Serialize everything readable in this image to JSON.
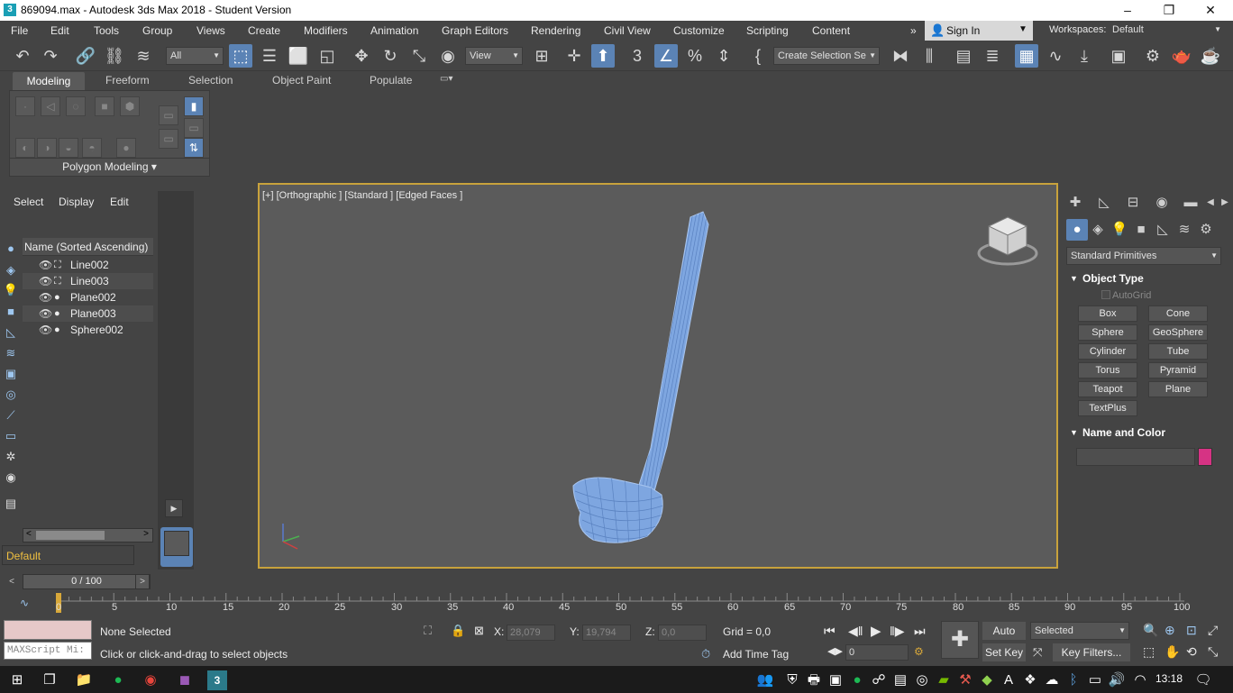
{
  "window": {
    "title": "869094.max - Autodesk 3ds Max 2018 - Student Version",
    "app_icon": "3",
    "min": "–",
    "restore": "❐",
    "close": "✕"
  },
  "menu": {
    "items": [
      "File",
      "Edit",
      "Tools",
      "Group",
      "Views",
      "Create",
      "Modifiers",
      "Animation",
      "Graph Editors",
      "Rendering",
      "Civil View",
      "Customize",
      "Scripting",
      "Content"
    ],
    "more": "»",
    "sign_in": "Sign In",
    "workspaces_label": "Workspaces:",
    "workspace_value": "Default"
  },
  "toolbar": {
    "filter_value": "All",
    "refcoord_value": "View",
    "selection_set_placeholder": "Create Selection Se"
  },
  "ribbon": {
    "tabs": [
      "Modeling",
      "Freeform",
      "Selection",
      "Object Paint",
      "Populate"
    ],
    "panel_label": "Polygon Modeling ▾"
  },
  "scene_explorer": {
    "tabs": [
      "Select",
      "Display",
      "Edit"
    ],
    "header": "Name (Sorted Ascending)",
    "rows": [
      {
        "name": "Line002",
        "type": "shape"
      },
      {
        "name": "Line003",
        "type": "shape"
      },
      {
        "name": "Plane002",
        "type": "geometry"
      },
      {
        "name": "Plane003",
        "type": "geometry"
      },
      {
        "name": "Sphere002",
        "type": "geometry"
      }
    ],
    "layer": "Default"
  },
  "viewport": {
    "label": "[+] [Orthographic ] [Standard ] [Edged Faces ]",
    "object_color": "#7ea6e0",
    "border_color": "#c8a23c"
  },
  "command_panel": {
    "category": "Standard Primitives",
    "object_type_title": "Object Type",
    "autogrid": "AutoGrid",
    "primitives": [
      "Box",
      "Cone",
      "Sphere",
      "GeoSphere",
      "Cylinder",
      "Tube",
      "Torus",
      "Pyramid",
      "Teapot",
      "Plane",
      "TextPlus"
    ],
    "name_color_title": "Name and Color",
    "object_color_swatch": "#d63384"
  },
  "timeline": {
    "slider": "0 / 100",
    "ticks": [
      "0",
      "5",
      "10",
      "15",
      "20",
      "25",
      "30",
      "35",
      "40",
      "45",
      "50",
      "55",
      "60",
      "65",
      "70",
      "75",
      "80",
      "85",
      "90",
      "95",
      "100"
    ]
  },
  "status": {
    "selection": "None Selected",
    "prompt": "Click or click-and-drag to select objects",
    "maxscript": "MAXScript Mi:",
    "x_label": "X:",
    "x_value": "28,079",
    "y_label": "Y:",
    "y_value": "19,794",
    "z_label": "Z:",
    "z_value": "0,0",
    "grid": "Grid = 0,0",
    "add_time_tag": "Add Time Tag",
    "auto_key": "Auto Key",
    "set_key": "Set Key",
    "selected_dropdown": "Selected",
    "key_filters": "Key Filters...",
    "frame": "0"
  },
  "taskbar": {
    "time": "13:18"
  }
}
